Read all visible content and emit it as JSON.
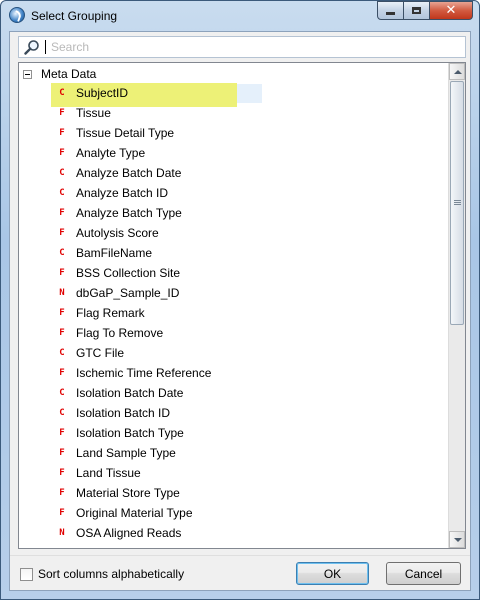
{
  "window": {
    "title": "Select Grouping"
  },
  "search": {
    "placeholder": "Search",
    "value": ""
  },
  "tree": {
    "root_label": "Meta Data",
    "items": [
      {
        "label": "SubjectID",
        "type": "C",
        "selected": true
      },
      {
        "label": "Tissue",
        "type": "F"
      },
      {
        "label": "Tissue Detail Type",
        "type": "F"
      },
      {
        "label": "Analyte Type",
        "type": "F"
      },
      {
        "label": "Analyze Batch Date",
        "type": "C"
      },
      {
        "label": "Analyze Batch ID",
        "type": "C"
      },
      {
        "label": "Analyze Batch Type",
        "type": "F"
      },
      {
        "label": "Autolysis Score",
        "type": "F"
      },
      {
        "label": "BamFileName",
        "type": "C"
      },
      {
        "label": "BSS Collection Site",
        "type": "F"
      },
      {
        "label": "dbGaP_Sample_ID",
        "type": "N"
      },
      {
        "label": "Flag Remark",
        "type": "F"
      },
      {
        "label": "Flag To Remove",
        "type": "F"
      },
      {
        "label": "GTC File",
        "type": "C"
      },
      {
        "label": "Ischemic Time Reference",
        "type": "F"
      },
      {
        "label": "Isolation Batch Date",
        "type": "C"
      },
      {
        "label": "Isolation Batch ID",
        "type": "C"
      },
      {
        "label": "Isolation Batch Type",
        "type": "F"
      },
      {
        "label": "Land Sample Type",
        "type": "F"
      },
      {
        "label": "Land Tissue",
        "type": "F"
      },
      {
        "label": "Material Store Type",
        "type": "F"
      },
      {
        "label": "Original Material Type",
        "type": "F"
      },
      {
        "label": "OSA Aligned Reads",
        "type": "N"
      }
    ]
  },
  "footer": {
    "sort_label": "Sort columns alphabetically",
    "sort_checked": false,
    "ok_label": "OK",
    "cancel_label": "Cancel"
  },
  "colors": {
    "highlight": "#ecf070",
    "type_icon": "#e00000"
  },
  "icons": {
    "app": "app-logo-icon",
    "search": "magnifier-icon",
    "expander": "collapse-minus-icon",
    "minimize": "minimize-icon",
    "maximize": "maximize-icon",
    "close": "close-icon"
  }
}
